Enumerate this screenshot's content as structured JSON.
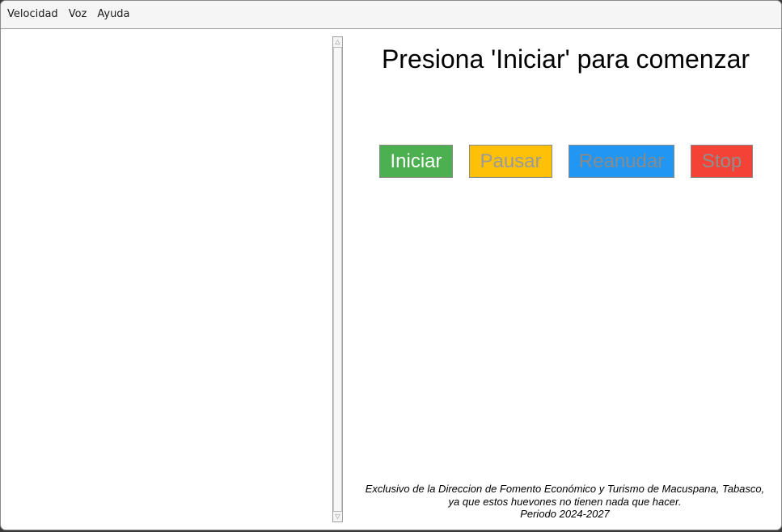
{
  "menubar": {
    "items": [
      "Velocidad",
      "Voz",
      "Ayuda"
    ]
  },
  "main": {
    "title": "Presiona 'Iniciar' para comenzar",
    "buttons": {
      "start": "Iniciar",
      "pause": "Pausar",
      "resume": "Reanudar",
      "stop": "Stop"
    },
    "footer": {
      "line1": "Exclusivo de la Direccion de Fomento Económico y Turismo de Macuspana, Tabasco,",
      "line2": "ya que estos huevones no tienen nada que hacer.",
      "line3": "Periodo 2024-2027"
    }
  },
  "scrollbar": {
    "up_arrow": "△",
    "down_arrow": "▽"
  },
  "colors": {
    "start": "#4caf50",
    "pause": "#ffc107",
    "resume": "#2196f3",
    "stop": "#f44336"
  }
}
